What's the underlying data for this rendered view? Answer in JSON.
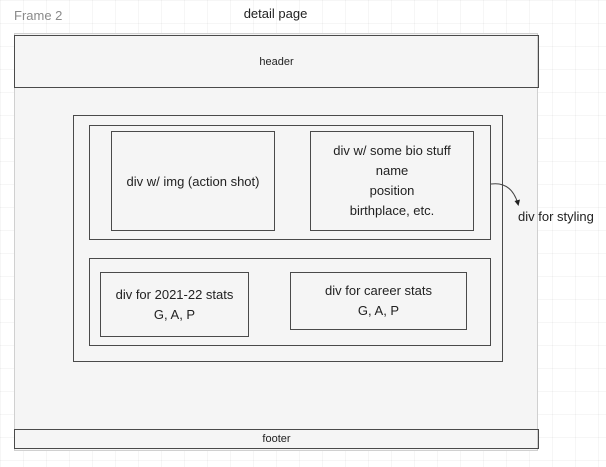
{
  "frame_label": "Frame 2",
  "page_title": "detail page",
  "header": {
    "label": "header"
  },
  "footer": {
    "label": "footer"
  },
  "image_div": {
    "label": "div w/ img (action shot)"
  },
  "bio_div": {
    "lines": [
      "div w/ some bio stuff",
      "name",
      "position",
      "birthplace, etc."
    ]
  },
  "season_stats_div": {
    "lines": [
      "div for 2021-22 stats",
      "G, A, P"
    ]
  },
  "career_stats_div": {
    "lines": [
      "div for career stats",
      "G, A, P"
    ]
  },
  "annotation": {
    "label": "div for styling"
  }
}
